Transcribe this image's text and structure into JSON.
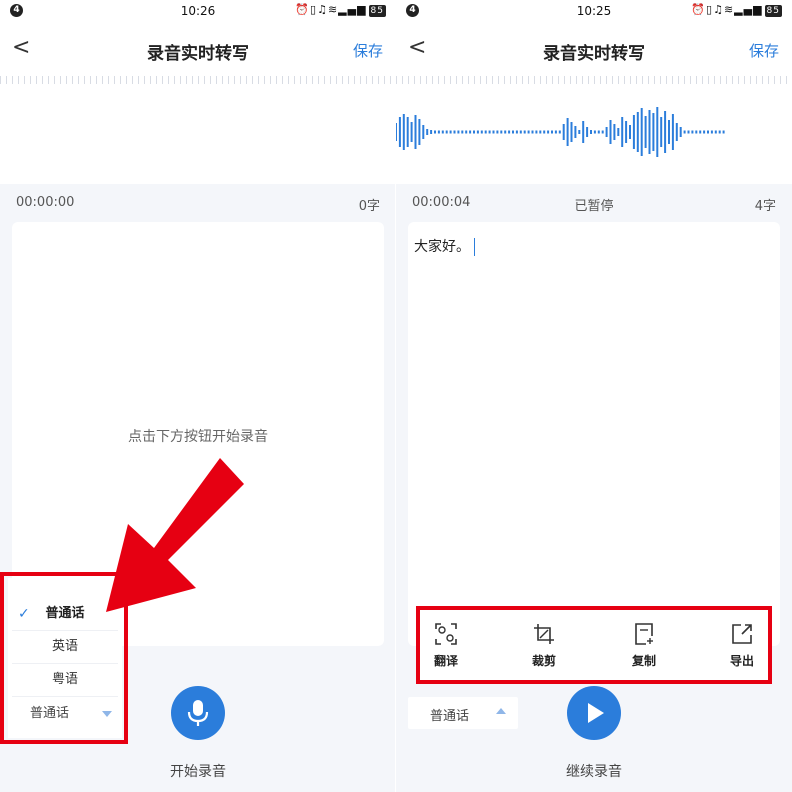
{
  "left": {
    "statusbar": {
      "notif": "4",
      "time": "10:26",
      "battery": "85"
    },
    "navbar": {
      "back": "<",
      "title": "录音实时转写",
      "save_label": "保存"
    },
    "info": {
      "elapsed": "00:00:00",
      "count": "0字"
    },
    "hint": "点击下方按钮开始录音",
    "language_menu": {
      "options": [
        {
          "label": "普通话",
          "selected": true
        },
        {
          "label": "英语",
          "selected": false
        },
        {
          "label": "粤语",
          "selected": false
        }
      ],
      "check": "✓",
      "current": "普通话"
    },
    "record_button_label": "开始录音"
  },
  "right": {
    "statusbar": {
      "notif": "4",
      "time": "10:25",
      "battery": "85"
    },
    "navbar": {
      "back": "<",
      "title": "录音实时转写",
      "save_label": "保存"
    },
    "info": {
      "elapsed": "00:00:04",
      "status": "已暂停",
      "count": "4字"
    },
    "transcript": "大家好。",
    "toolbar": [
      {
        "label": "翻译",
        "icon": "translate-icon"
      },
      {
        "label": "裁剪",
        "icon": "crop-icon"
      },
      {
        "label": "复制",
        "icon": "copy-icon"
      },
      {
        "label": "导出",
        "icon": "export-icon"
      }
    ],
    "language": "普通话",
    "resume_button_label": "继续录音"
  },
  "colors": {
    "accent": "#2b7ddb",
    "highlight": "#e60012",
    "background": "#f4f6fa"
  }
}
